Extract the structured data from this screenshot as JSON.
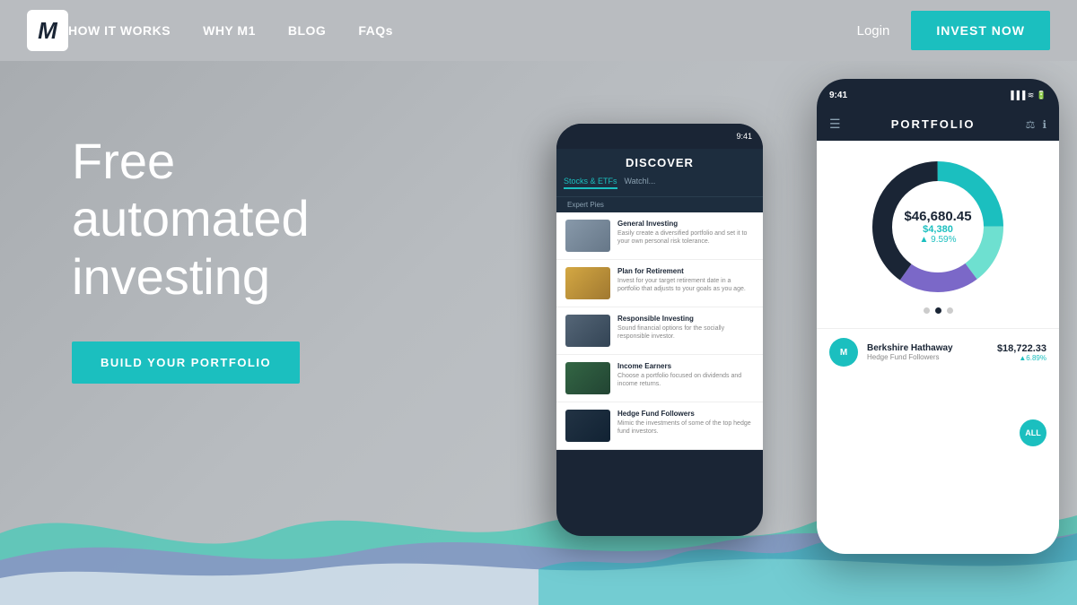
{
  "nav": {
    "logo_letter": "M",
    "links": [
      {
        "id": "how-it-works",
        "label": "HOW IT WORKS"
      },
      {
        "id": "why-m1",
        "label": "WHY M1"
      },
      {
        "id": "blog",
        "label": "BLOG"
      },
      {
        "id": "faqs",
        "label": "FAQs"
      }
    ],
    "login_label": "Login",
    "invest_label": "INVEST NOW"
  },
  "hero": {
    "heading_line1": "Free",
    "heading_line2": "automated",
    "heading_line3": "investing",
    "cta_label": "BUILD YOUR PORTFOLIO"
  },
  "phone_left": {
    "time": "9:41",
    "title": "DISCOVER",
    "tab_stocks": "Stocks & ETFs",
    "tab_watchlist": "Watchl...",
    "subtitle": "Expert Pies",
    "items": [
      {
        "title": "General Investing",
        "desc": "Easily create a diversified portfolio and set it to your own personal risk tolerance.",
        "img_class": "img-mountain"
      },
      {
        "title": "Plan for Retirement",
        "desc": "Invest for your target retirement date in a portfolio that adjusts to your goals as you age.",
        "img_class": "img-beach"
      },
      {
        "title": "Responsible Investing",
        "desc": "Sound financial options for the socially responsible investor.",
        "img_class": "img-city"
      },
      {
        "title": "Income Earners",
        "desc": "Choose a portfolio focused on dividends and income returns.",
        "img_class": "img-money"
      },
      {
        "title": "Hedge Fund Followers",
        "desc": "Mimic the investments of some of the top hedge fund investors.",
        "img_class": "img-hedge"
      }
    ]
  },
  "phone_right": {
    "time": "9:41",
    "status_icons": "▐▐▐ ≋ ⬛",
    "title": "PORTFOLIO",
    "portfolio_value": "$46,680.45",
    "portfolio_gain": "$4,380",
    "portfolio_pct": "▲ 9.59%",
    "all_label": "ALL",
    "holding_name": "Berkshire Hathaway",
    "holding_subtitle": "Hedge Fund Followers",
    "holding_value": "$18,722.33",
    "holding_pct": "▲6.89%"
  },
  "colors": {
    "teal": "#1bbfbf",
    "dark_navy": "#1a2535",
    "purple": "#7b68c8",
    "light_teal": "#6ee0d0",
    "wave_purple": "#9b7fc8",
    "wave_teal": "#4dc9b8",
    "wave_white": "#e8f4f4"
  }
}
